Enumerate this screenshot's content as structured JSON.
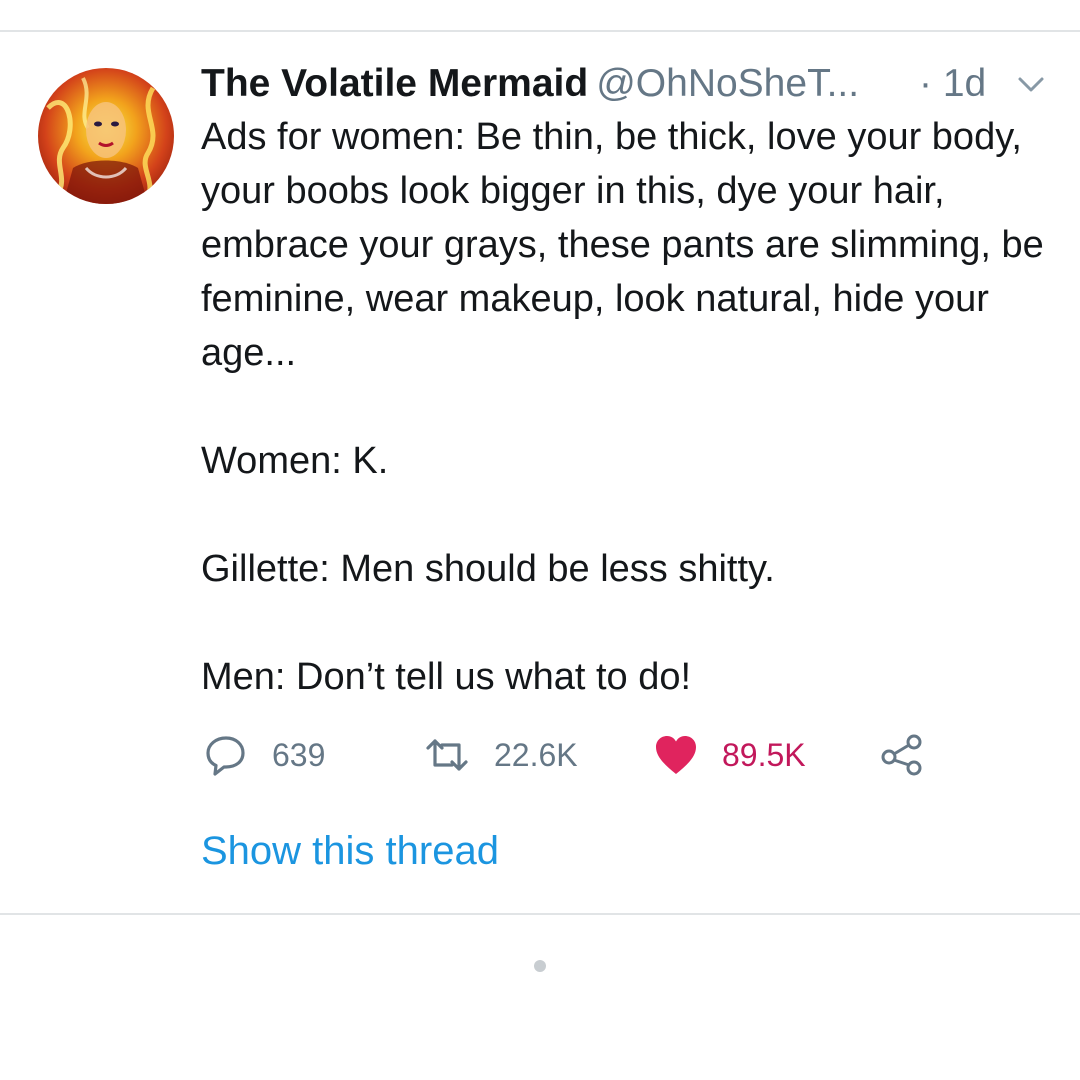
{
  "tweet": {
    "author": {
      "display_name": "The Volatile Mermaid",
      "handle": "@OhNoSheT...",
      "time": "· 1d"
    },
    "body": {
      "paragraph_1": "Ads for women: Be thin, be thick, love your body, your boobs look bigger in this, dye your hair, embrace your grays, these pants are slimming, be feminine, wear makeup, look natural, hide your age...",
      "paragraph_2": "Women: K.",
      "paragraph_3": "Gillette: Men should be less shitty.",
      "paragraph_4": "Men: Don’t tell us what to do!"
    },
    "actions": {
      "replies": "639",
      "retweets": "22.6K",
      "likes": "89.5K",
      "liked": true
    },
    "show_thread": "Show this thread"
  },
  "icons": {
    "reply": "reply-icon",
    "retweet": "retweet-icon",
    "like": "heart-icon",
    "share": "share-icon",
    "more": "chevron-down-icon"
  },
  "colors": {
    "text": "#14171a",
    "secondary": "#657786",
    "link": "#1b95e0",
    "like": "#e0245e",
    "like_count": "#c2185b",
    "divider": "#e1e4e6"
  }
}
